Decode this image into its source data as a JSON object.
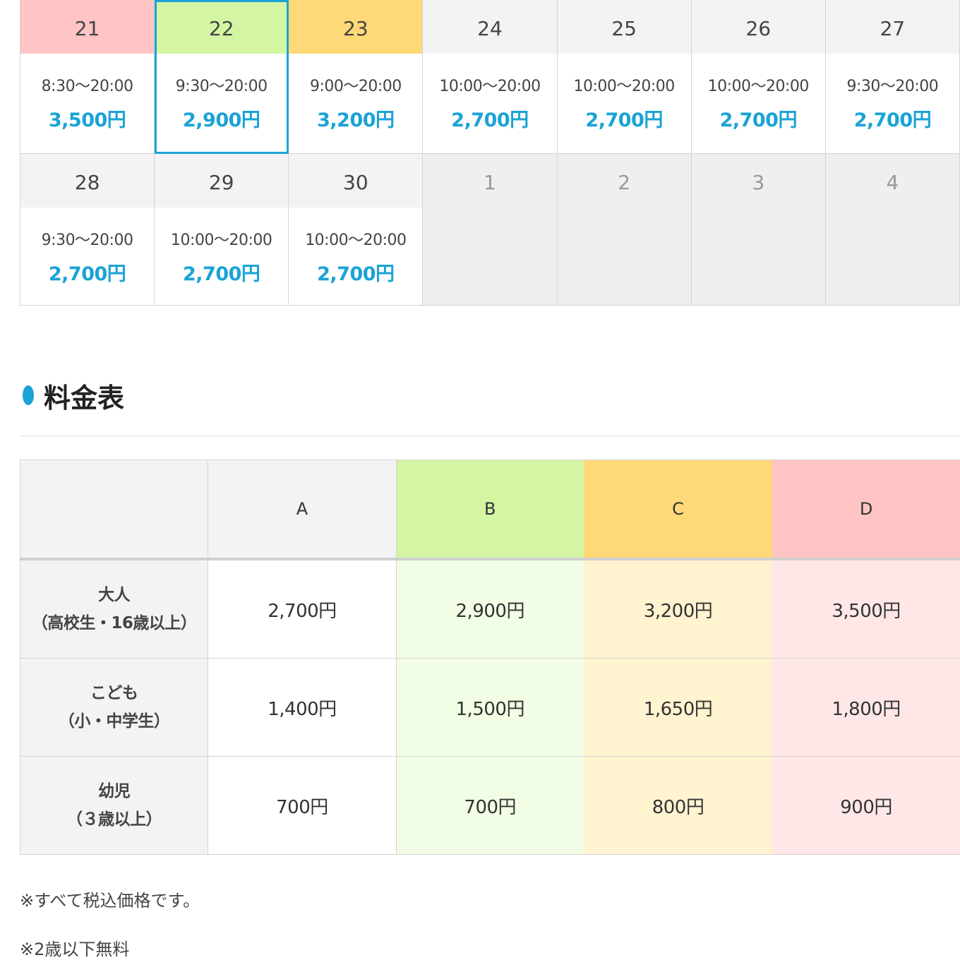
{
  "calendar": {
    "days": [
      {
        "day": "21",
        "hours": "8:30〜20:00",
        "price": "3,500円",
        "rate": "d",
        "in_month": true,
        "selected": false
      },
      {
        "day": "22",
        "hours": "9:30〜20:00",
        "price": "2,900円",
        "rate": "b",
        "in_month": true,
        "selected": true
      },
      {
        "day": "23",
        "hours": "9:00〜20:00",
        "price": "3,200円",
        "rate": "c",
        "in_month": true,
        "selected": false
      },
      {
        "day": "24",
        "hours": "10:00〜20:00",
        "price": "2,700円",
        "rate": "a",
        "in_month": true,
        "selected": false
      },
      {
        "day": "25",
        "hours": "10:00〜20:00",
        "price": "2,700円",
        "rate": "a",
        "in_month": true,
        "selected": false
      },
      {
        "day": "26",
        "hours": "10:00〜20:00",
        "price": "2,700円",
        "rate": "a",
        "in_month": true,
        "selected": false
      },
      {
        "day": "27",
        "hours": "9:30〜20:00",
        "price": "2,700円",
        "rate": "a",
        "in_month": true,
        "selected": false
      },
      {
        "day": "28",
        "hours": "9:30〜20:00",
        "price": "2,700円",
        "rate": "a",
        "in_month": true,
        "selected": false
      },
      {
        "day": "29",
        "hours": "10:00〜20:00",
        "price": "2,700円",
        "rate": "a",
        "in_month": true,
        "selected": false
      },
      {
        "day": "30",
        "hours": "10:00〜20:00",
        "price": "2,700円",
        "rate": "a",
        "in_month": true,
        "selected": false
      },
      {
        "day": "1",
        "hours": "",
        "price": "",
        "rate": "out",
        "in_month": false,
        "selected": false
      },
      {
        "day": "2",
        "hours": "",
        "price": "",
        "rate": "out",
        "in_month": false,
        "selected": false
      },
      {
        "day": "3",
        "hours": "",
        "price": "",
        "rate": "out",
        "in_month": false,
        "selected": false
      },
      {
        "day": "4",
        "hours": "",
        "price": "",
        "rate": "out",
        "in_month": false,
        "selected": false
      }
    ]
  },
  "price_section": {
    "title": "料金表",
    "columns": [
      "A",
      "B",
      "C",
      "D"
    ],
    "rows": [
      {
        "label_line1": "大人",
        "label_line2": "（高校生・16歳以上）",
        "prices": [
          "2,700円",
          "2,900円",
          "3,200円",
          "3,500円"
        ]
      },
      {
        "label_line1": "こども",
        "label_line2": "（小・中学生）",
        "prices": [
          "1,400円",
          "1,500円",
          "1,650円",
          "1,800円"
        ]
      },
      {
        "label_line1": "幼児",
        "label_line2": "（３歳以上）",
        "prices": [
          "700円",
          "700円",
          "800円",
          "900円"
        ]
      }
    ]
  },
  "notes": [
    "※すべて税込価格です。",
    "※2歳以下無料"
  ],
  "colors": {
    "accent": "#1aa3d6",
    "rate_a": "#f3f3f3",
    "rate_b": "#d4f5a3",
    "rate_c": "#ffd977",
    "rate_d": "#ffc4c4"
  }
}
